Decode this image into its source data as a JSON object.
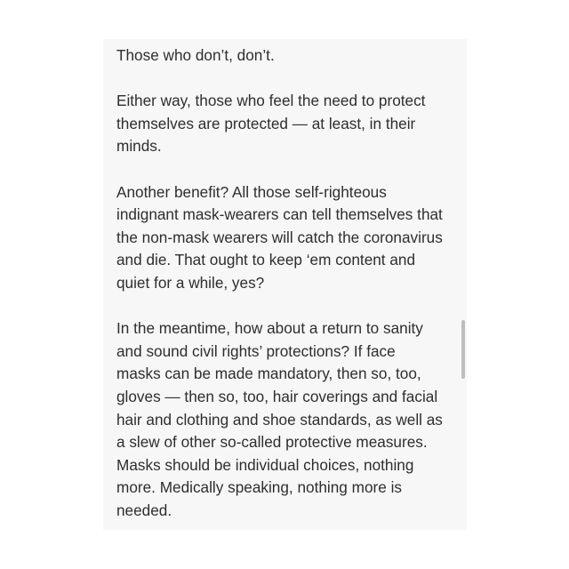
{
  "note": {
    "paragraphs": [
      "Those who don’t, don’t.",
      "Either way, those who feel the need to protect\nthemselves are protected — at least, in their\nminds.",
      "Another benefit? All those self-righteous\nindignant mask-wearers can tell themselves that\nthe non-mask wearers will catch the coronavirus\nand die. That ought to keep ‘em content and\nquiet for a while, yes?",
      "In the meantime, how about a return to sanity\nand sound civil rights’ protections? If face\nmasks can be made mandatory, then so, too,\ngloves — then so, too, hair coverings and facial\nhair and clothing and shoe standards, as well as\na slew of other so-called protective measures.\nMasks should be individual choices, nothing\nmore. Medically speaking, nothing more is\nneeded."
    ]
  },
  "colors": {
    "background": "#ffffff",
    "panel": "#f7f7f7",
    "text": "#2e2e2e",
    "scrollbar": "#bdbdbd"
  }
}
